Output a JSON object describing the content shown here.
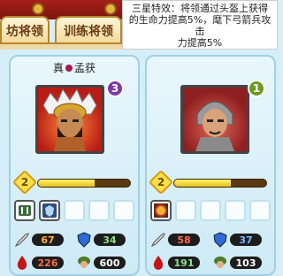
{
  "tabs": [
    {
      "label": "坊将领"
    },
    {
      "label": "训练将领"
    }
  ],
  "tooltip": {
    "lines": [
      "三星特效：将领通过头盔上获得",
      "的生命力提高5%，麾下弓箭兵攻击",
      "力提高5%"
    ]
  },
  "cards": [
    {
      "name_prefix": "真",
      "name_suffix": "孟获",
      "rank": "3",
      "level": "2",
      "level_progress": 0.62,
      "attack": "67",
      "defense": "34",
      "hp": "226",
      "troops": "600"
    },
    {
      "name_prefix": "",
      "name_suffix": "",
      "rank": "1",
      "level": "2",
      "level_progress": 0.62,
      "attack": "58",
      "defense": "37",
      "hp": "191",
      "troops": "103"
    }
  ],
  "colors": {
    "attack": "#ffb23a",
    "defense": "#8fe08a",
    "hp": "#ff6a4a",
    "troops": "#ffffff"
  },
  "icons": {
    "attack": "sword-icon",
    "defense": "shield-icon",
    "hp": "blood-drop-icon",
    "troops": "soldier-icon"
  }
}
